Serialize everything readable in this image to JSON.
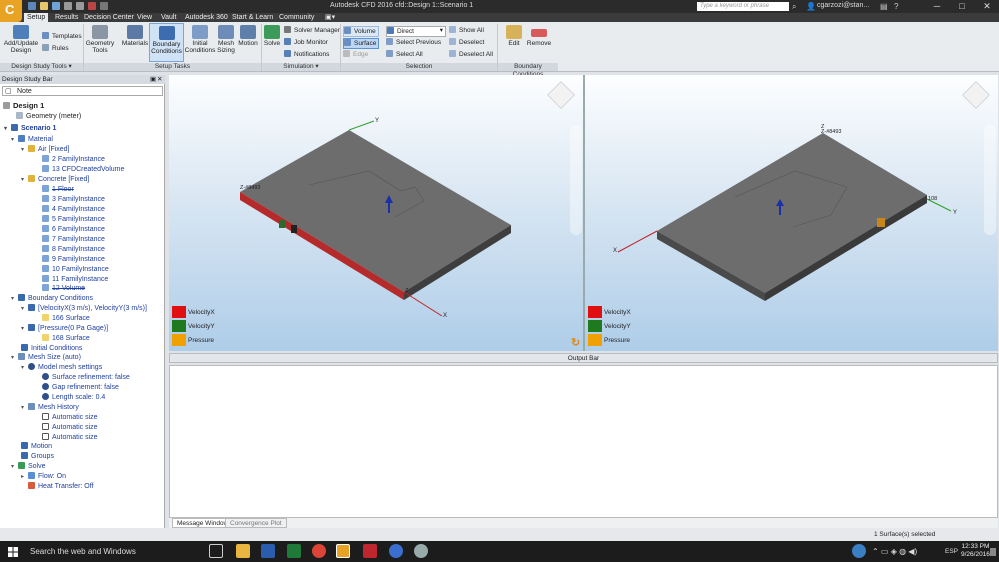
{
  "window": {
    "title": "Autodesk CFD 2016   cfd::Design 1::Scenario 1",
    "search_placeholder": "Type a keyword or phrase",
    "user": "cgarzozi@stan...",
    "minimize": "─",
    "maximize": "□",
    "close": "✕"
  },
  "tabs": [
    "Setup",
    "Results",
    "Decision Center",
    "View",
    "Vault",
    "Autodesk 360",
    "Start & Learn",
    "Community"
  ],
  "ribbon": {
    "add_update_design": "Add/Update\nDesign",
    "templates": "Templates",
    "rules": "Rules",
    "geometry_tools": "Geometry\nTools",
    "materials": "Materials",
    "boundary_conditions": "Boundary\nConditions",
    "initial_conditions": "Initial\nConditions",
    "mesh_sizing": "Mesh\nSizing",
    "motion": "Motion",
    "solve": "Solve",
    "solver_manager": "Solver Manager",
    "job_monitor": "Job Monitor",
    "notifications": "Notifications",
    "volume": "Volume",
    "surface": "Surface",
    "edge": "Edge",
    "direct": "Direct",
    "select_previous": "Select Previous",
    "select_all": "Select All",
    "show_all": "Show All",
    "deselect": "Deselect",
    "deselect_all": "Deselect All",
    "edit": "Edit",
    "remove": "Remove",
    "groups": {
      "design_study_tools": "Design Study Tools ▾",
      "setup_tasks": "Setup Tasks",
      "simulation": "Simulation ▾",
      "selection": "Selection",
      "boundary_conditions": "Boundary Conditions"
    }
  },
  "sidebar": {
    "title": "Design Study Bar",
    "note": "Note",
    "tree": {
      "design": "Design 1",
      "geometry": "Geometry (meter)",
      "scenario": "Scenario 1",
      "material": "Material",
      "air": "Air [Fixed]",
      "air_items": [
        "2 FamilyInstance",
        "13 CFDCreatedVolume"
      ],
      "concrete": "Concrete [Fixed]",
      "concrete_items": [
        "1 Floor",
        "3 FamilyInstance",
        "4 FamilyInstance",
        "5 FamilyInstance",
        "6 FamilyInstance",
        "7 FamilyInstance",
        "8 FamilyInstance",
        "9 FamilyInstance",
        "10 FamilyInstance",
        "11 FamilyInstance",
        "12 Volume"
      ],
      "boundary_conditions": "Boundary Conditions",
      "bc_velocity": "[VelocityX(3 m/s), VelocityY(3 m/s)]",
      "bc_velocity_surface": "166 Surface",
      "bc_pressure": "[Pressure(0 Pa Gage)]",
      "bc_pressure_surface": "168 Surface",
      "initial_conditions": "Initial Conditions",
      "mesh_size": "Mesh Size (auto)",
      "model_mesh_settings": "Model mesh settings",
      "mesh_settings": [
        "Surface refinement: false",
        "Gap refinement: false",
        "Length scale: 0.4"
      ],
      "mesh_history": "Mesh History",
      "mesh_history_items": [
        "Automatic size",
        "Automatic size",
        "Automatic size"
      ],
      "motion": "Motion",
      "groups": "Groups",
      "solve": "Solve",
      "flow": "Flow: On",
      "heat_transfer": "Heat Transfer: Off"
    }
  },
  "viewport1": {
    "legend": [
      {
        "label": "VelocityX",
        "color": "#e01010"
      },
      {
        "label": "VelocityY",
        "color": "#1f7a1f"
      },
      {
        "label": "Pressure",
        "color": "#f0a000"
      }
    ],
    "axis_x": "X",
    "axis_y": "Y",
    "axis_z": "Z",
    "corner_label": "Z-#8493"
  },
  "viewport2": {
    "legend": [
      {
        "label": "VelocityX",
        "color": "#e01010"
      },
      {
        "label": "VelocityY",
        "color": "#1f7a1f"
      },
      {
        "label": "Pressure",
        "color": "#f0a000"
      }
    ],
    "axis_x": "X",
    "axis_y": "Y",
    "axis_z": "Z",
    "corner_label": "Z-#8493",
    "side_label": "108"
  },
  "output": {
    "title": "Output Bar",
    "tabs": [
      "Message Window",
      "Convergence Plot"
    ]
  },
  "status": {
    "selection": "1 Surface(s) selected"
  },
  "taskbar": {
    "search": "Search the web and Windows",
    "lang": "ESP",
    "time": "12:33 PM",
    "date": "9/26/2016"
  }
}
